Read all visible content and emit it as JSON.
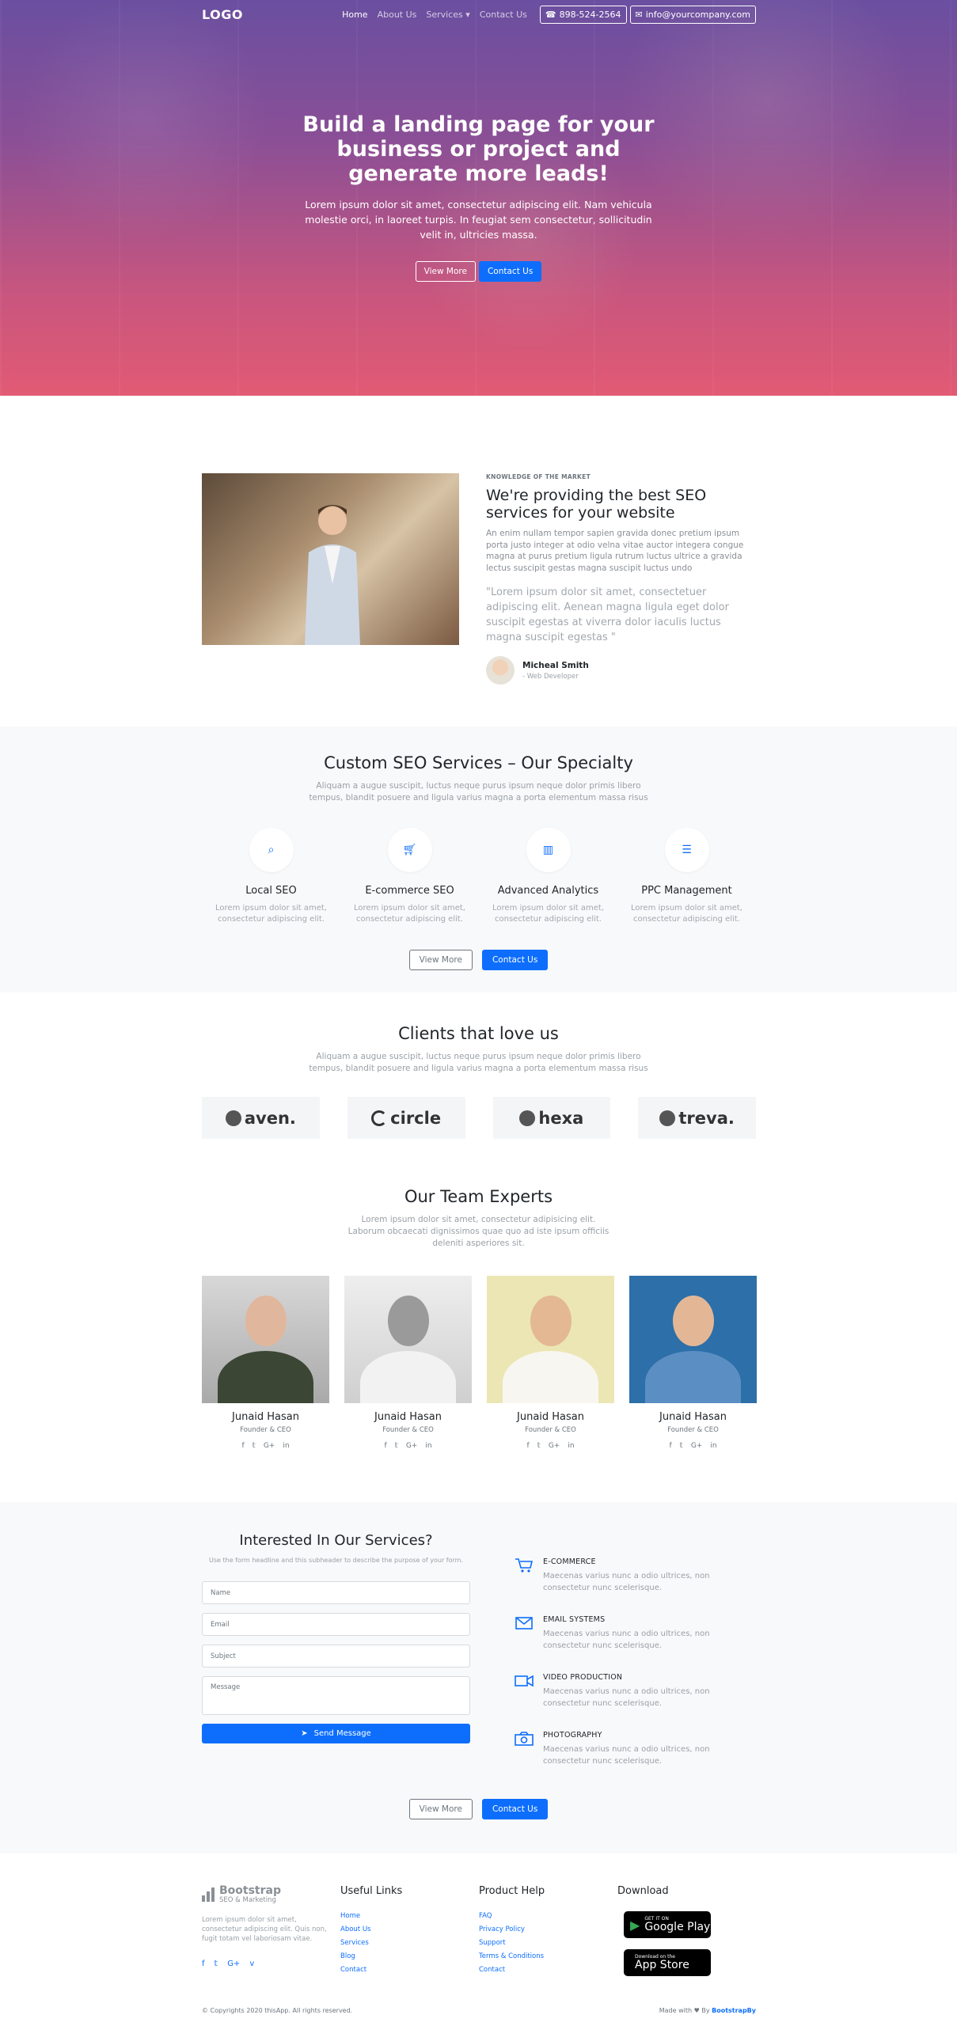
{
  "nav": {
    "logo": "LOGO",
    "items": [
      "Home",
      "About Us",
      "Services",
      "Contact Us"
    ],
    "phone": "898-524-2564",
    "email": "info@yourcompany.com"
  },
  "hero": {
    "title": "Build a landing page for your business or project and generate more leads!",
    "text": "Lorem ipsum dolor sit amet, consectetur adipiscing elit. Nam vehicula molestie orci, in laoreet turpis. In feugiat sem consectetur, sollicitudin velit in, ultricies massa.",
    "view_more": "View More",
    "contact": "Contact Us"
  },
  "about": {
    "kicker": "KNOWLEDGE OF THE MARKET",
    "title": "We're providing the best SEO services for your website",
    "lead": "An enim nullam tempor sapien gravida donec pretium ipsum porta justo integer at odio velna vitae auctor integera congue magna at purus pretium ligula rutrum luctus ultrice a gravida lectus suscipit gestas magna suscipit luctus undo",
    "quote": "\"Lorem ipsum dolor sit amet, consectetuer adipiscing elit. Aenean magna ligula eget dolor suscipit egestas at viverra dolor iaculis luctus magna suscipit egestas \"",
    "author_name": "Micheal Smith",
    "author_role": "- Web Developer"
  },
  "services": {
    "title": "Custom SEO Services – Our Specialty",
    "subtitle": "Aliquam a augue suscipit, luctus neque purus ipsum neque dolor primis libero tempus, blandit posuere and ligula varius magna a porta elementum massa risus",
    "items": [
      {
        "title": "Local SEO",
        "text": "Lorem ipsum dolor sit amet, consectetur adipiscing elit.",
        "icon": "search-icon"
      },
      {
        "title": "E-commerce SEO",
        "text": "Lorem ipsum dolor sit amet, consectetur adipiscing elit.",
        "icon": "cart-icon"
      },
      {
        "title": "Advanced Analytics",
        "text": "Lorem ipsum dolor sit amet, consectetur adipiscing elit.",
        "icon": "chart-icon"
      },
      {
        "title": "PPC Management",
        "text": "Lorem ipsum dolor sit amet, consectetur adipiscing elit.",
        "icon": "list-icon"
      }
    ],
    "view_more": "View More",
    "contact": "Contact Us"
  },
  "clients": {
    "title": "Clients that love us",
    "subtitle": "Aliquam a augue suscipit, luctus neque purus ipsum neque dolor primis libero tempus, blandit posuere and ligula varius magna a porta elementum massa risus",
    "logos": [
      "aven.",
      "circle",
      "hexa",
      "treva."
    ]
  },
  "team": {
    "title": "Our Team Experts",
    "subtitle": "Lorem ipsum dolor sit amet, consectetur adipisicing elit. Laborum obcaecati dignissimos quae quo ad iste ipsum officiis deleniti asperiores sit.",
    "members": [
      {
        "name": "Junaid Hasan",
        "role": "Founder & CEO"
      },
      {
        "name": "Junaid Hasan",
        "role": "Founder & CEO"
      },
      {
        "name": "Junaid Hasan",
        "role": "Founder & CEO"
      },
      {
        "name": "Junaid Hasan",
        "role": "Founder & CEO"
      }
    ]
  },
  "contact": {
    "title": "Interested In Our Services?",
    "hint": "Use the form headline and this subheader to describe the purpose of your form.",
    "name_ph": "Name",
    "email_ph": "Email",
    "subject_ph": "Subject",
    "message_ph": "Message",
    "send": "Send Message",
    "features": [
      {
        "title": "E-COMMERCE",
        "text": "Maecenas varius nunc a odio ultrices, non consectetur nunc scelerisque."
      },
      {
        "title": "EMAIL SYSTEMS",
        "text": "Maecenas varius nunc a odio ultrices, non consectetur nunc scelerisque."
      },
      {
        "title": "VIDEO PRODUCTION",
        "text": "Maecenas varius nunc a odio ultrices, non consectetur nunc scelerisque."
      },
      {
        "title": "PHOTOGRAPHY",
        "text": "Maecenas varius nunc a odio ultrices, non consectetur nunc scelerisque."
      }
    ],
    "view_more": "View More",
    "contact": "Contact Us"
  },
  "footer": {
    "brand": "Bootstrap",
    "brand_sub": "SEO & Marketing",
    "desc": "Lorem ipsum dolor sit amet, consectetur adipiscing elit. Quis non, fugit totam vel laboriosam vitae.",
    "useful_title": "Useful Links",
    "useful": [
      "Home",
      "About Us",
      "Services",
      "Blog",
      "Contact"
    ],
    "help_title": "Product Help",
    "help": [
      "FAQ",
      "Privacy Policy",
      "Support",
      "Terms & Conditions",
      "Contact"
    ],
    "download_title": "Download",
    "gp_small": "GET IT ON",
    "gp_big": "Google Play",
    "as_small": "Download on the",
    "as_big": "App Store",
    "copyright": "© Copyrights 2020 thisApp. All rights reserved.",
    "made_with": "Made with",
    "by": "By",
    "made_by": "BootstrapBy"
  }
}
